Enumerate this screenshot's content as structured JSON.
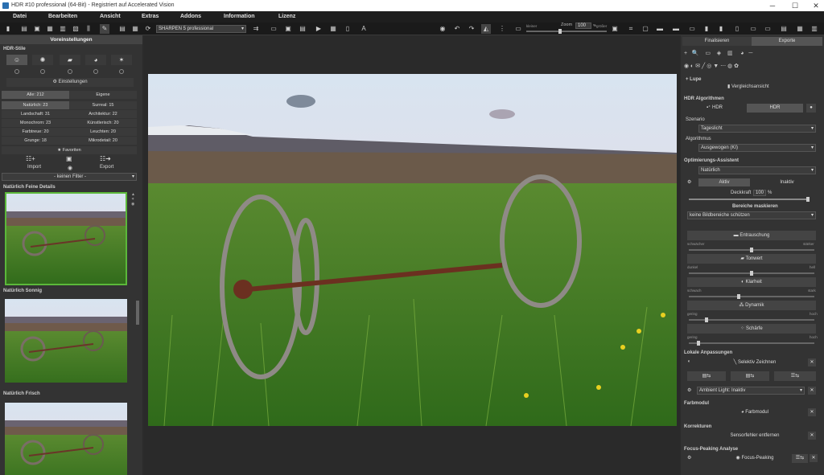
{
  "window": {
    "title": "HDR #10 professional (64-Bit) - Registriert auf Accelerated Vision",
    "minimize": "─",
    "maximize": "☐",
    "close": "✕"
  },
  "menu": [
    "Datei",
    "Bearbeiten",
    "Ansicht",
    "Extras",
    "Addons",
    "Information",
    "Lizenz"
  ],
  "toolbar": {
    "sharpen_select": "SHARPEN 5 professional",
    "zoom_label": "Zoom",
    "zoom_value": "100",
    "zoom_unit": "%",
    "smaller": "kleiner",
    "larger": "größer"
  },
  "left": {
    "header": "Voreinstellungen",
    "hdr_styles": "HDR-Stile",
    "settings_button": "Einstellungen",
    "tab_all": "Alle: 212",
    "tab_own": "Eigene",
    "categories": [
      [
        "Natürlich: 23",
        "Surreal: 15"
      ],
      [
        "Landschaft: 31",
        "Architektur: 22"
      ],
      [
        "Monochrom: 23",
        "Künstlerisch: 20"
      ],
      [
        "Farbtreue: 20",
        "Leuchten: 20"
      ],
      [
        "Grunge: 18",
        "Mikrodetail: 20"
      ]
    ],
    "favorites": "Favoriten",
    "import": "Import",
    "export": "Export",
    "filter": "- keinen Filter -",
    "presets": [
      {
        "name": "Natürlich Feine Details"
      },
      {
        "name": "Natürlich Sonnig"
      },
      {
        "name": "Natürlich Frisch"
      }
    ]
  },
  "right": {
    "tab_finalize": "Finalisieren",
    "tab_export": "Exporte",
    "lupe": "Lupe",
    "compare": "Vergleichsansicht",
    "hdr_algorithms": "HDR Algorithmen",
    "hdr_btn": "HDR",
    "hdr_btn2": "HDR",
    "szenario": "Szenario",
    "szenario_value": "Tageslicht",
    "algorithmus": "Algorithmus",
    "algorithmus_value": "Ausgewogen (KI)",
    "opt_assistant": "Optimierungs-Assistent",
    "opt_value": "Natürlich",
    "aktiv": "Aktiv",
    "inaktiv": "Inaktiv",
    "deckkraft": "Deckkraft",
    "deckkraft_value": "100",
    "deckkraft_unit": "%",
    "mask_areas": "Bereiche maskieren",
    "mask_value": "keine Bildbereiche schützen",
    "noise": "Entrauschung",
    "weaker": "schwächer",
    "stronger": "stärker",
    "tone": "Tonwert",
    "dark": "dunkel",
    "bright": "hell",
    "clarity": "Klarheit",
    "soft": "schwach",
    "hard": "stark",
    "dynamics": "Dynamik",
    "low": "gering",
    "high": "hoch",
    "sharpness": "Schärfe",
    "low2": "gering",
    "high2": "hoch",
    "local_adj": "Lokale Anpassungen",
    "selective": "Selektiv Zeichnen",
    "ambient": "Ambient Light: Inaktiv",
    "color_module": "Farbmodul",
    "color_module_btn": "Farbmodul",
    "corrections": "Korrekturen",
    "sensor": "Sensorfehler entfernen",
    "focus_analysis": "Focus-Peaking Analyse",
    "focus_btn": "Focus-Peaking"
  },
  "colors": {
    "accent_green": "#5bb83a",
    "panel": "#333333",
    "toolbar": "#1a1a1a"
  }
}
